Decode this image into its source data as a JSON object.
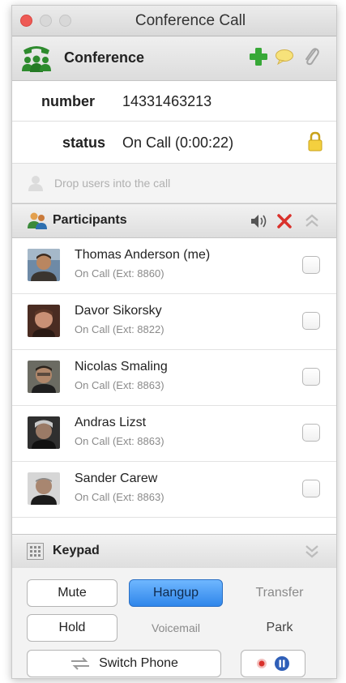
{
  "window": {
    "title": "Conference Call"
  },
  "header": {
    "title": "Conference",
    "icons": [
      "conference-icon",
      "add-icon",
      "chat-bubble-icon",
      "paperclip-icon"
    ]
  },
  "info": {
    "number_label": "number",
    "number_value": "14331463213",
    "status_label": "status",
    "status_value": "On Call (0:00:22)"
  },
  "drop": {
    "text": "Drop users into the call"
  },
  "participants": {
    "title": "Participants",
    "items": [
      {
        "name": "Thomas Anderson (me)",
        "status": "On Call (Ext: 8860)"
      },
      {
        "name": "Davor Sikorsky",
        "status": "On Call (Ext: 8822)"
      },
      {
        "name": "Nicolas Smaling",
        "status": "On Call (Ext: 8863)"
      },
      {
        "name": "Andras Lizst",
        "status": "On Call (Ext: 8863)"
      },
      {
        "name": "Sander Carew",
        "status": "On Call (Ext: 8863)"
      }
    ]
  },
  "keypad": {
    "title": "Keypad",
    "mute": "Mute",
    "hangup": "Hangup",
    "transfer": "Transfer",
    "hold": "Hold",
    "voicemail": "Voicemail",
    "park": "Park",
    "switch_phone": "Switch Phone"
  },
  "colors": {
    "accent_blue": "#3a8ee6",
    "green": "#2f9e2f",
    "close_red": "#ee5a55",
    "lock_yellow": "#f1c40f",
    "delete_red": "#d9312b"
  }
}
